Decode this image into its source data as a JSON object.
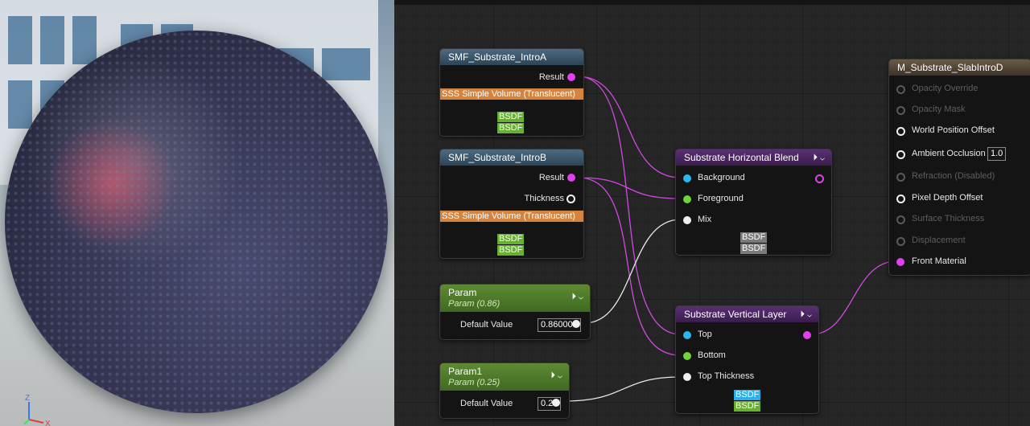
{
  "viewport": {
    "axis": {
      "z": "Z",
      "x": "X"
    }
  },
  "nodes": {
    "intro_a": {
      "title": "SMF_Substrate_IntroA",
      "result": "Result",
      "sss": "SSS Simple Volume (Translucent)",
      "badges": [
        "BSDF",
        "BSDF"
      ]
    },
    "intro_b": {
      "title": "SMF_Substrate_IntroB",
      "result": "Result",
      "thickness": "Thickness",
      "sss": "SSS Simple Volume (Translucent)",
      "badges": [
        "BSDF",
        "BSDF"
      ]
    },
    "param": {
      "title": "Param",
      "subtitle": "Param (0.86)",
      "default_label": "Default Value",
      "default_value": "0.860001"
    },
    "param1": {
      "title": "Param1",
      "subtitle": "Param (0.25)",
      "default_label": "Default Value",
      "default_value": "0.25"
    },
    "horizontal_blend": {
      "title": "Substrate Horizontal Blend",
      "background": "Background",
      "foreground": "Foreground",
      "mix": "Mix",
      "badges": [
        "BSDF",
        "BSDF"
      ]
    },
    "vertical_layer": {
      "title": "Substrate Vertical Layer",
      "top": "Top",
      "bottom": "Bottom",
      "top_thickness": "Top Thickness",
      "badges": [
        "BSDF",
        "BSDF"
      ]
    },
    "material": {
      "title": "M_Substrate_SlabIntroD",
      "pins": {
        "opacity_override": "Opacity Override",
        "opacity_mask": "Opacity Mask",
        "world_position_offset": "World Position Offset",
        "ambient_occlusion": "Ambient Occlusion",
        "ambient_occlusion_value": "1.0",
        "refraction": "Refraction (Disabled)",
        "pixel_depth_offset": "Pixel Depth Offset",
        "surface_thickness": "Surface Thickness",
        "displacement": "Displacement",
        "front_material": "Front Material"
      }
    }
  },
  "colors": {
    "pin_magenta": "#e040f0",
    "pin_blue": "#2ab8f0",
    "pin_green": "#6ed43a",
    "sss_orange": "#d4843e",
    "bsdf_green": "#68b030",
    "bsdf_gray": "#7a7a7a",
    "bsdf_blue": "#2ab0e8"
  }
}
